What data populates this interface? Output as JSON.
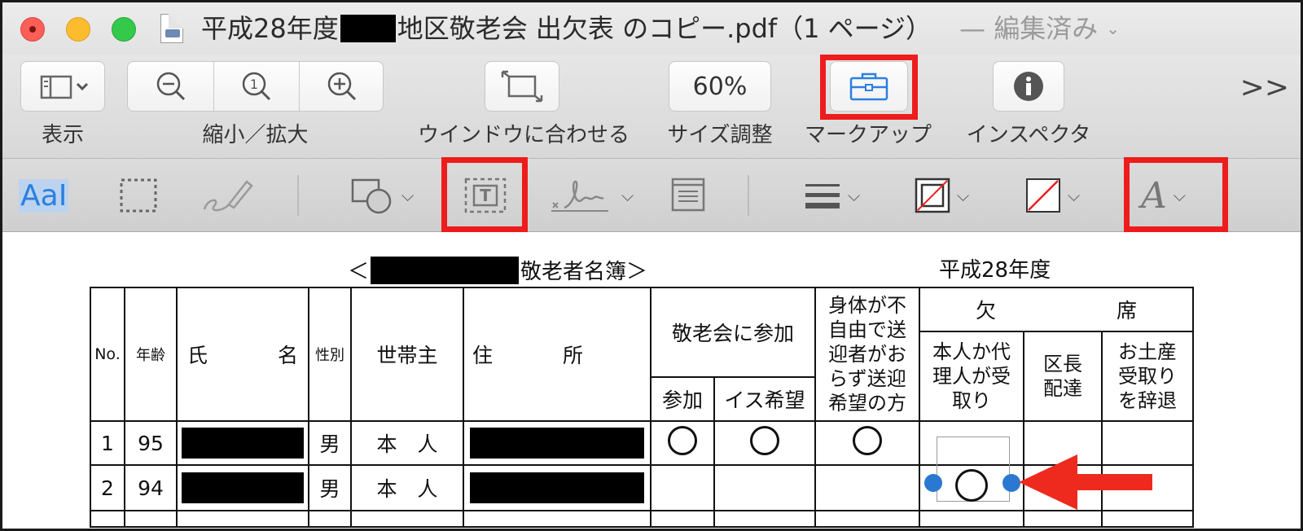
{
  "window": {
    "title_prefix": "平成28年度",
    "title_suffix": "地区敬老会 出欠表 のコピー.pdf（1 ページ）",
    "edited_label": "— 編集済み"
  },
  "toolbar": {
    "view_label": "表示",
    "zoom_label": "縮小／拡大",
    "fit_label": "ウインドウに合わせる",
    "size_value": "60%",
    "size_label": "サイズ調整",
    "markup_label": "マークアップ",
    "inspector_label": "インスペクタ",
    "more_label": ">>"
  },
  "markup_tools": {
    "text_style_label": "AaI"
  },
  "document": {
    "heading_open": "＜",
    "heading_text": "敬老者名簿＞",
    "year": "平成28年度",
    "headers": {
      "no": "No.",
      "age": "年齢",
      "name_1": "氏",
      "name_2": "名",
      "sex": "性別",
      "head": "世帯主",
      "addr_1": "住",
      "addr_2": "所",
      "attend": "敬老会に参加",
      "attend_join": "参加",
      "attend_chair": "イス希望",
      "transport": "身体が不自由で送迎者がおらず送迎希望の方",
      "absent_1": "欠",
      "absent_2": "席",
      "proxy": "本人か代理人が受取り",
      "chief": "区長配達",
      "decline": "お土産受取りを辞退"
    },
    "rows": [
      {
        "no": "1",
        "age": "95",
        "sex": "男",
        "head": "本　人"
      },
      {
        "no": "2",
        "age": "94",
        "sex": "男",
        "head": "本　人"
      }
    ]
  },
  "colors": {
    "highlight": "#ee1c1c",
    "selection": "#2b78d0",
    "arrow": "#ee2a1e"
  }
}
